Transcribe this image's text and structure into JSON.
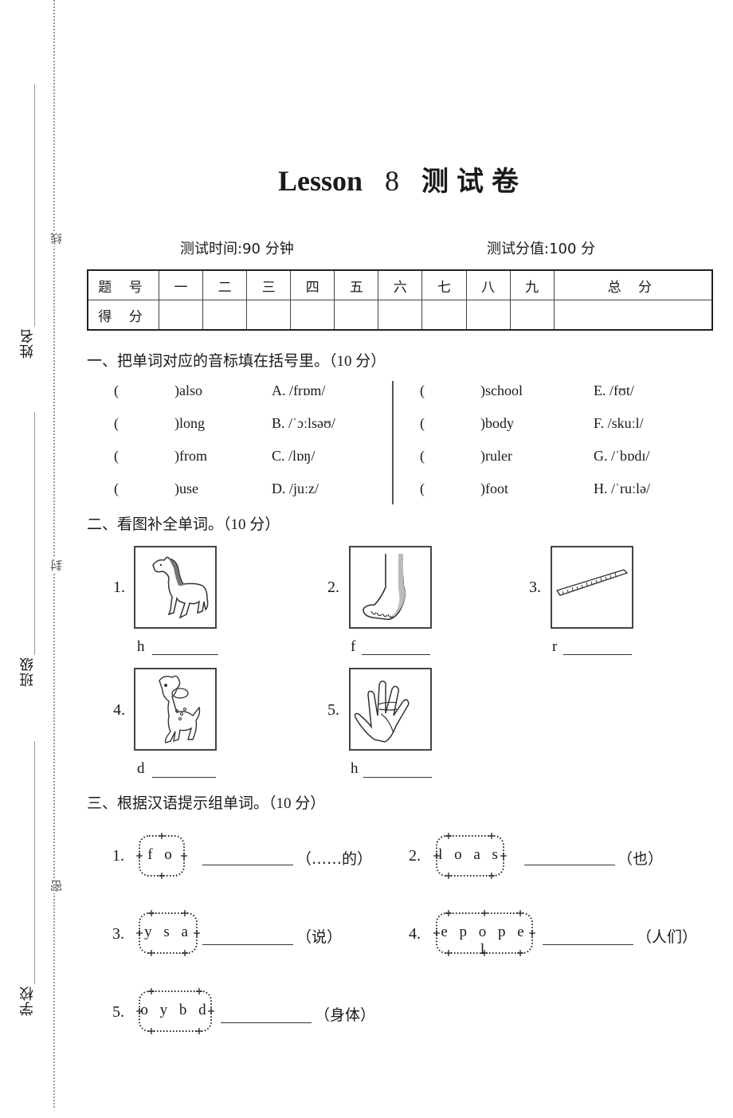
{
  "binding_margin": {
    "fields": [
      {
        "label": "姓名"
      },
      {
        "label": "班级"
      },
      {
        "label": "学校"
      }
    ],
    "seal_marks": [
      "线",
      "封",
      "密"
    ]
  },
  "header": {
    "title_en": "Lesson",
    "lesson_number": "8",
    "title_cn": "测试卷",
    "test_time": "测试时间:90 分钟",
    "test_score": "测试分值:100 分"
  },
  "score_table": {
    "row1_label": "题 号",
    "row2_label": "得 分",
    "columns": [
      "一",
      "二",
      "三",
      "四",
      "五",
      "六",
      "七",
      "八",
      "九",
      "总 分"
    ],
    "scores": [
      "",
      "",
      "",
      "",
      "",
      "",
      "",
      "",
      "",
      ""
    ]
  },
  "section1": {
    "title": "一、把单词对应的音标填在括号里。",
    "points": "（10 分）",
    "left_items": [
      {
        "answer": "",
        "word": "also",
        "option": "A. /frɒm/"
      },
      {
        "answer": "",
        "word": "long",
        "option": "B. /ˈɔːlsəʊ/"
      },
      {
        "answer": "",
        "word": "from",
        "option": "C. /lɒŋ/"
      },
      {
        "answer": "",
        "word": "use",
        "option": "D. /juːz/"
      }
    ],
    "right_items": [
      {
        "answer": "",
        "word": "school",
        "option": "E. /fʊt/"
      },
      {
        "answer": "",
        "word": "body",
        "option": "F. /skuːl/"
      },
      {
        "answer": "",
        "word": "ruler",
        "option": "G. /ˈbɒdɪ/"
      },
      {
        "answer": "",
        "word": "foot",
        "option": "H. /ˈruːlə/"
      }
    ]
  },
  "section2": {
    "title": "二、看图补全单词。",
    "points": "（10 分）",
    "items": [
      {
        "number": "1.",
        "picture": "horse-picture",
        "first_letter": "h",
        "answer": ""
      },
      {
        "number": "2.",
        "picture": "foot-picture",
        "first_letter": "f",
        "answer": ""
      },
      {
        "number": "3.",
        "picture": "ruler-picture",
        "first_letter": "r",
        "answer": ""
      },
      {
        "number": "4.",
        "picture": "deer-picture",
        "first_letter": "d",
        "answer": ""
      },
      {
        "number": "5.",
        "picture": "hand-picture",
        "first_letter": "h",
        "answer": ""
      }
    ]
  },
  "section3": {
    "title": "三、根据汉语提示组单词。",
    "points": "（10 分）",
    "items": [
      {
        "number": "1.",
        "letters": "f o",
        "hint": "（……的）",
        "answer": ""
      },
      {
        "number": "2.",
        "letters": "l o a s",
        "hint": "（也）",
        "answer": ""
      },
      {
        "number": "3.",
        "letters": "y s a",
        "hint": "（说）",
        "answer": ""
      },
      {
        "number": "4.",
        "letters": "e p o p e l",
        "hint": "（人们）",
        "answer": ""
      },
      {
        "number": "5.",
        "letters": "o y b d",
        "hint": "（身体）",
        "answer": ""
      }
    ]
  }
}
